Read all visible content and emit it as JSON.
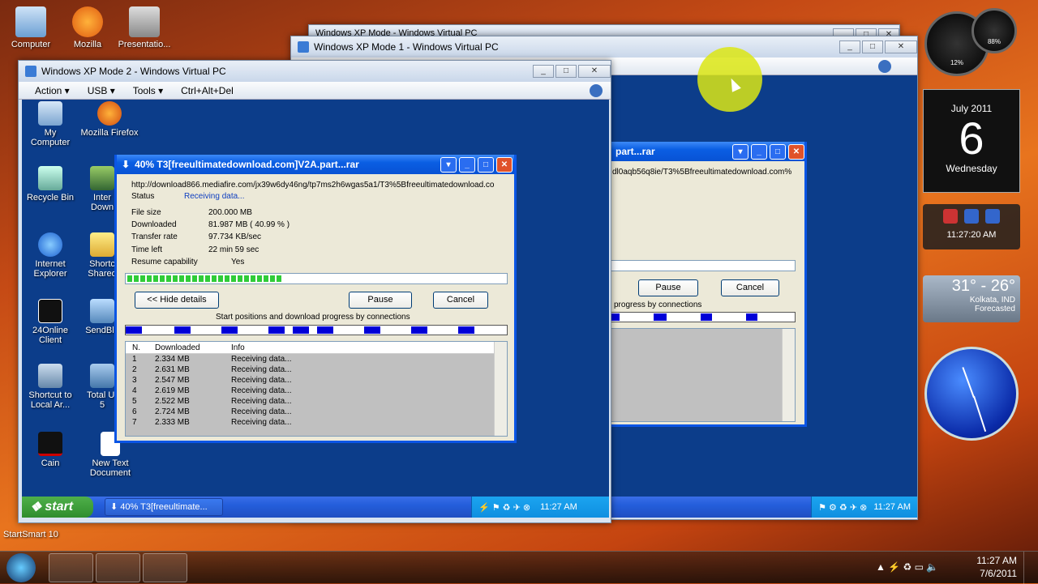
{
  "desktop": {
    "icons": [
      {
        "label": "Computer"
      },
      {
        "label": "Mozilla"
      },
      {
        "label": "Presentatio..."
      }
    ],
    "startsmart": "StartSmart 10"
  },
  "vm1": {
    "title": "Windows XP Mode - Windows Virtual PC"
  },
  "vm2": {
    "title": "Windows XP Mode 1 - Windows Virtual PC",
    "dialog_title": "part...rar",
    "url": "dl0aqb56q8ie/T3%5Bfreeultimatedownload.com%",
    "pause": "Pause",
    "cancel": "Cancel",
    "conn_label": "progress by connections",
    "clock": "11:27 AM"
  },
  "vm3": {
    "title": "Windows XP Mode 2 - Windows Virtual PC",
    "menu": [
      "Action ▾",
      "USB ▾",
      "Tools ▾",
      "Ctrl+Alt+Del"
    ],
    "icons": [
      {
        "label": "My Computer"
      },
      {
        "label": "Mozilla Firefox"
      },
      {
        "label": "Recycle Bin"
      },
      {
        "label": "Inter Down"
      },
      {
        "label": "Internet Explorer"
      },
      {
        "label": "Shortc Shared"
      },
      {
        "label": "24Online Client"
      },
      {
        "label": "SendBla"
      },
      {
        "label": "Shortcut to Local Ar..."
      },
      {
        "label": "Total Ur 5"
      },
      {
        "label": "Cain"
      },
      {
        "label": "New Text Document"
      }
    ],
    "start": "start",
    "task_item": "40% T3[freeultimate...",
    "clock": "11:27 AM"
  },
  "download": {
    "title": "40% T3[freeultimatedownload.com]V2A.part...rar",
    "url": "http://download866.mediafire.com/jx39w6dy46ng/tp7ms2h6wgas5a1/T3%5Bfreeultimatedownload.co",
    "status_label": "Status",
    "status_value": "Receiving data...",
    "file_size_label": "File size",
    "file_size": "200.000  MB",
    "downloaded_label": "Downloaded",
    "downloaded": "81.987  MB  ( 40.99 % )",
    "rate_label": "Transfer rate",
    "rate": "97.734  KB/sec",
    "time_left_label": "Time left",
    "time_left": "22 min 59 sec",
    "resume_label": "Resume capability",
    "resume": "Yes",
    "progress": 0.41,
    "hide_btn": "<< Hide details",
    "pause_btn": "Pause",
    "cancel_btn": "Cancel",
    "conn_label": "Start positions and download progress by connections",
    "cols": [
      "N.",
      "Downloaded",
      "Info"
    ],
    "rows": [
      {
        "n": "1",
        "dl": "2.334  MB",
        "info": "Receiving data..."
      },
      {
        "n": "2",
        "dl": "2.631  MB",
        "info": "Receiving data..."
      },
      {
        "n": "3",
        "dl": "2.547  MB",
        "info": "Receiving data..."
      },
      {
        "n": "4",
        "dl": "2.619  MB",
        "info": "Receiving data..."
      },
      {
        "n": "5",
        "dl": "2.522  MB",
        "info": "Receiving data..."
      },
      {
        "n": "6",
        "dl": "2.724  MB",
        "info": "Receiving data..."
      },
      {
        "n": "7",
        "dl": "2.333  MB",
        "info": "Receiving data..."
      }
    ]
  },
  "gadgets": {
    "month": "July 2011",
    "day": "6",
    "weekday": "Wednesday",
    "time": "11:27:20 AM",
    "temp": "31° - 26°",
    "location": "Kolkata, IND",
    "forecast": "Forecasted",
    "meter": "88%",
    "meter2": "12%"
  },
  "taskbar": {
    "time": "11:27 AM",
    "date": "7/6/2011"
  }
}
